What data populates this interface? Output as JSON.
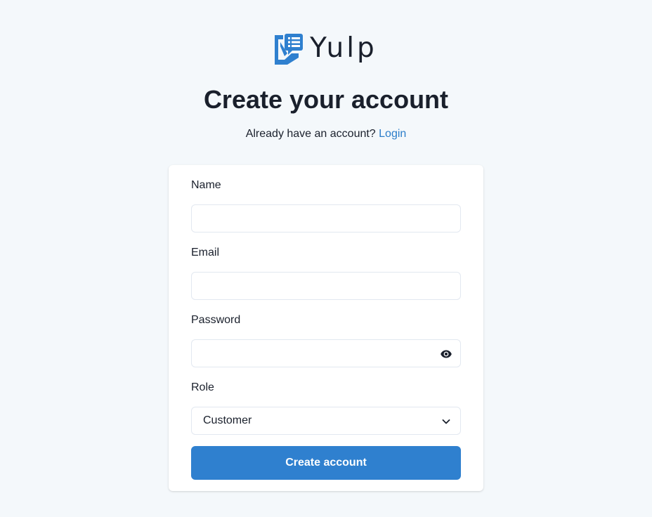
{
  "brand": {
    "name": "Yulp",
    "icon": "chat-list-logo-icon",
    "color": "#2f80cf"
  },
  "header": {
    "title": "Create your account",
    "prompt": "Already have an account?",
    "login_link": "Login"
  },
  "form": {
    "name": {
      "label": "Name",
      "value": ""
    },
    "email": {
      "label": "Email",
      "value": ""
    },
    "password": {
      "label": "Password",
      "value": "",
      "toggle_icon": "eye-icon"
    },
    "role": {
      "label": "Role",
      "selected": "Customer",
      "icon": "chevron-down-icon"
    },
    "submit_label": "Create account"
  },
  "colors": {
    "background": "#f4f8fb",
    "accent": "#2f80cf",
    "link": "#2b7dc9",
    "text": "#1a202c"
  }
}
